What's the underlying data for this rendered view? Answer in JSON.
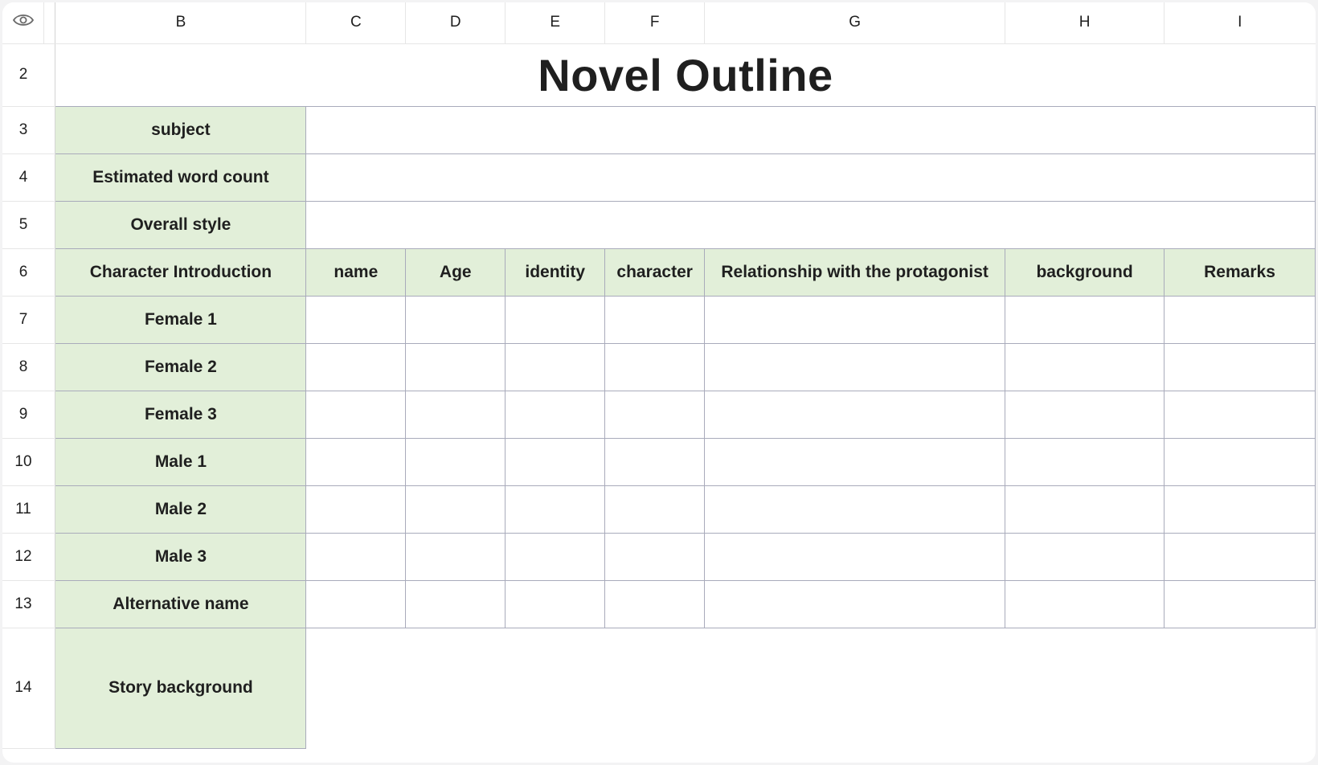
{
  "icons": {
    "visibility": "eye-icon"
  },
  "columns": [
    "B",
    "C",
    "D",
    "E",
    "F",
    "G",
    "H",
    "I"
  ],
  "rows": [
    "2",
    "3",
    "4",
    "5",
    "6",
    "7",
    "8",
    "9",
    "10",
    "11",
    "12",
    "13",
    "14"
  ],
  "title": "Novel Outline",
  "labels": {
    "subject": "subject",
    "word_count": "Estimated word count",
    "style": "Overall style",
    "characters": "Character Introduction",
    "female1": "Female 1",
    "female2": "Female 2",
    "female3": "Female 3",
    "male1": "Male 1",
    "male2": "Male 2",
    "male3": "Male 3",
    "alt_name": "Alternative name",
    "background": "Story background"
  },
  "character_headers": [
    "name",
    "Age",
    "identity",
    "character",
    "Relationship with the protagonist",
    "background",
    "Remarks"
  ],
  "colors": {
    "label_fill": "#e2efd9",
    "border": "#a9abbb"
  }
}
